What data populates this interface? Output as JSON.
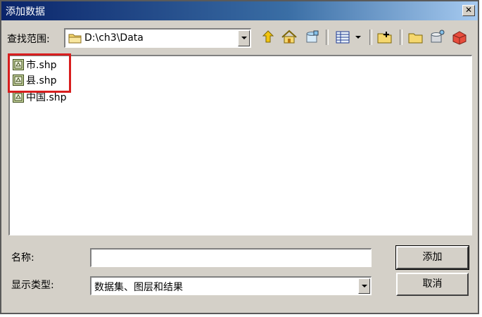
{
  "window": {
    "title": "添加数据",
    "close_glyph": "✕"
  },
  "location": {
    "label": "查找范围:",
    "value": "D:\\ch3\\Data"
  },
  "toolbar": {
    "icons": [
      "up-folder-icon",
      "home-icon",
      "catalog-icon",
      "list-view-icon",
      "view-menu-arrow-icon",
      "connect-folder-icon",
      "new-folder-icon",
      "geodatabase-icon",
      "toolbox-icon"
    ]
  },
  "files": [
    {
      "name": "市.shp",
      "icon": "shapefile-icon"
    },
    {
      "name": "县.shp",
      "icon": "shapefile-icon"
    },
    {
      "name": "中国.shp",
      "icon": "shapefile-icon"
    }
  ],
  "name_field": {
    "label": "名称:",
    "value": ""
  },
  "type_field": {
    "label": "显示类型:",
    "value": "数据集、图层和结果"
  },
  "buttons": {
    "add": "添加",
    "cancel": "取消"
  },
  "colors": {
    "highlight": "#d81e1e",
    "titlebar": "#0a246a",
    "dialog": "#d4d0c8"
  }
}
